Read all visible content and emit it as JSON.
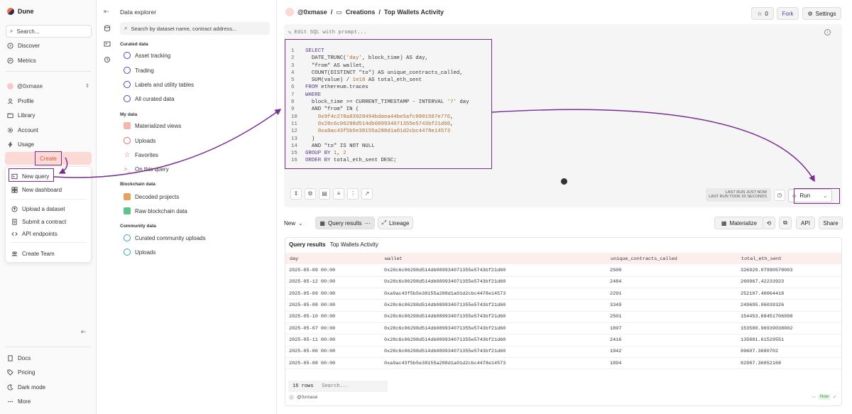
{
  "app": {
    "name": "Dune"
  },
  "leftnav": {
    "search_placeholder": "Search...",
    "top_items": [
      {
        "label": "Discover",
        "icon": "compass-icon"
      },
      {
        "label": "Metrics",
        "icon": "chart-icon"
      }
    ],
    "user": "@0xmase",
    "mid_items": [
      {
        "label": "Profile",
        "icon": "user-icon"
      },
      {
        "label": "Library",
        "icon": "folder-icon"
      },
      {
        "label": "Account",
        "icon": "gear-icon"
      },
      {
        "label": "Usage",
        "icon": "lightning-icon"
      }
    ],
    "create_label": "Create",
    "create_menu": [
      {
        "label": "New query",
        "icon": "query-icon"
      },
      {
        "label": "New dashboard",
        "icon": "grid-icon"
      },
      {
        "label": "Upload a dataset",
        "icon": "upload-icon"
      },
      {
        "label": "Submit a contract",
        "icon": "contract-icon"
      },
      {
        "label": "API endpoints",
        "icon": "api-icon"
      },
      {
        "label": "Create Team",
        "icon": "team-icon"
      }
    ],
    "bottom_items": [
      {
        "label": "Docs",
        "icon": "doc-icon"
      },
      {
        "label": "Pricing",
        "icon": "tag-icon"
      },
      {
        "label": "Dark mode",
        "icon": "moon-icon"
      },
      {
        "label": "More",
        "icon": "dots-icon"
      }
    ]
  },
  "explorer": {
    "title": "Data explorer",
    "search_placeholder": "Search by dataset name, contract address...",
    "sections": [
      {
        "title": "Curated data",
        "items": [
          "Asset tracking",
          "Trading",
          "Labels and utility tables",
          "All curated data"
        ]
      },
      {
        "title": "My data",
        "items": [
          "Materialized views",
          "Uploads",
          "Favorites",
          "On this query"
        ]
      },
      {
        "title": "Blockchain data",
        "items": [
          "Decoded projects",
          "Raw blockchain data"
        ]
      },
      {
        "title": "Community data",
        "items": [
          "Curated community uploads",
          "Uploads"
        ]
      }
    ]
  },
  "header": {
    "user": "@0xmase",
    "separator": "/",
    "folder": "Creations",
    "title": "Top Wallets Activity",
    "star_count": "0",
    "fork_label": "Fork",
    "settings_label": "Settings"
  },
  "editor": {
    "prompt_placeholder": "Edit SQL with prompt...",
    "lines": [
      [
        [
          "kw",
          "SELECT"
        ]
      ],
      [
        [
          "plain",
          "  DATE_TRUNC("
        ],
        [
          "str",
          "'day'"
        ],
        [
          "plain",
          ", block_time) AS day,"
        ]
      ],
      [
        [
          "plain",
          "  \"from\" AS wallet,"
        ]
      ],
      [
        [
          "plain",
          "  COUNT(DISTINCT \"to\") AS unique_contracts_called,"
        ]
      ],
      [
        [
          "plain",
          "  SUM(value) / "
        ],
        [
          "num",
          "1e18"
        ],
        [
          "plain",
          " AS total_eth_sent"
        ]
      ],
      [
        [
          "kw",
          "FROM"
        ],
        [
          "plain",
          " ethereum.traces"
        ]
      ],
      [
        [
          "kw",
          "WHERE"
        ]
      ],
      [
        [
          "plain",
          "  block_time >= CURRENT_TIMESTAMP - INTERVAL "
        ],
        [
          "str",
          "'7'"
        ],
        [
          "plain",
          " day"
        ]
      ],
      [
        [
          "plain",
          "  AND \"from\" IN ("
        ]
      ],
      [
        [
          "str",
          "    0x9f4c278a83928494bdaea44be5afc9901507e776"
        ],
        [
          "plain",
          ","
        ]
      ],
      [
        [
          "str",
          "    0x28c6c06298d514db089934071355e5743bf21d60"
        ],
        [
          "plain",
          ","
        ]
      ],
      [
        [
          "str",
          "    0xa9ac43f5b5e38155a288d1a01d2cbc4478e14573"
        ]
      ],
      [
        [
          "plain",
          "  )"
        ]
      ],
      [
        [
          "plain",
          "  AND \"to\" IS NOT NULL"
        ]
      ],
      [
        [
          "kw",
          "GROUP BY"
        ],
        [
          "plain",
          " "
        ],
        [
          "num",
          "1"
        ],
        [
          "plain",
          ", "
        ],
        [
          "num",
          "2"
        ]
      ],
      [
        [
          "kw",
          "ORDER BY"
        ],
        [
          "plain",
          " total_eth_sent DESC;"
        ]
      ]
    ],
    "last_run_1": "LAST RUN JUST NOW",
    "last_run_2": "LAST RUN TOOK 20 SECONDS",
    "run_label": "Run"
  },
  "results_bar": {
    "new_label": "New",
    "query_results_label": "Query results",
    "lineage_label": "Lineage",
    "materialize_label": "Materialize",
    "api_label": "API",
    "share_label": "Share"
  },
  "results": {
    "title": "Query results",
    "subtitle": "Top Wallets Activity",
    "columns": [
      "day",
      "wallet",
      "unique_contracts_called",
      "total_eth_sent"
    ],
    "rows": [
      [
        "2025-05-09 00:00",
        "0x28c6c06298d514db089934071355e5743bf21d60",
        "2500",
        "326929.07990578003"
      ],
      [
        "2025-05-12 00:00",
        "0x28c6c06298d514db089934071355e5743bf21d60",
        "2484",
        "260967.42233923"
      ],
      [
        "2025-05-09 00:00",
        "0xa9ac43f5b5e38155a288d1a01d2cbc4478e14573",
        "2291",
        "252107.40064418"
      ],
      [
        "2025-05-08 00:00",
        "0x28c6c06298d514db089934071355e5743bf21d60",
        "3349",
        "249695.06039326"
      ],
      [
        "2025-05-10 00:00",
        "0x28c6c06298d514db089934071355e5743bf21d60",
        "2501",
        "154453.68451706998"
      ],
      [
        "2025-05-07 00:00",
        "0x28c6c06298d514db089934071355e5743bf21d60",
        "1897",
        "153589.96939038002"
      ],
      [
        "2025-05-11 00:00",
        "0x28c6c06298d514db089934071355e5743bf21d60",
        "2416",
        "135881.61529551"
      ],
      [
        "2025-05-06 00:00",
        "0x28c6c06298d514db089934071355e5743bf21d60",
        "1942",
        "89607.3680702"
      ],
      [
        "2025-05-08 00:00",
        "0xa9ac43f5b5e38155a288d1a01d2cbc4478e14573",
        "1894",
        "82987.36852168"
      ]
    ],
    "row_count": "16 rows",
    "search_placeholder": "Search...",
    "footer_user": "@0xmase",
    "now_badge": "Now"
  }
}
